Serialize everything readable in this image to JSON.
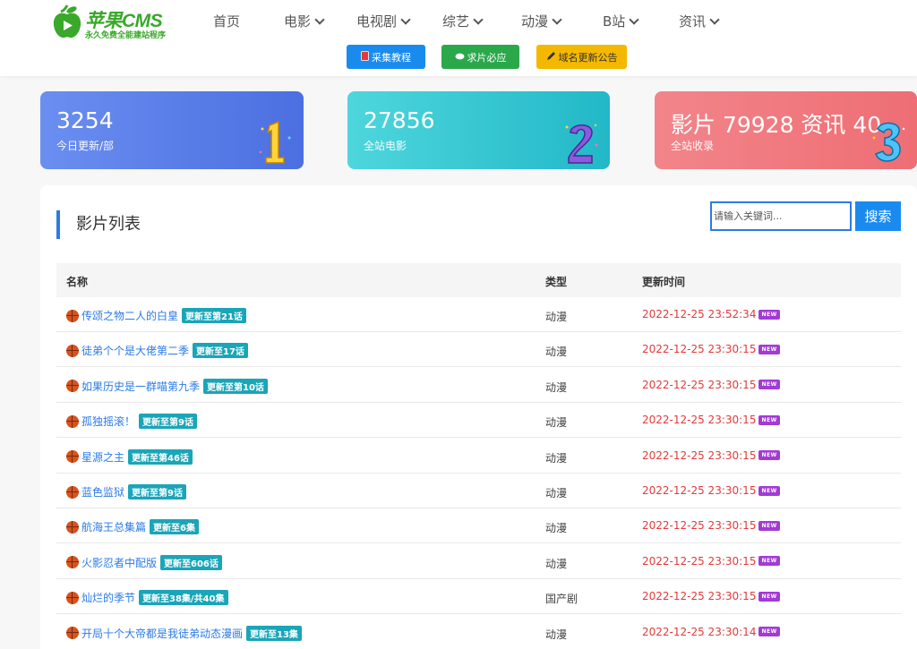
{
  "brand": {
    "title": "苹果CMS",
    "subtitle": "永久免费全能建站程序"
  },
  "nav": [
    {
      "label": "首页",
      "has_menu": false
    },
    {
      "label": "电影",
      "has_menu": true
    },
    {
      "label": "电视剧",
      "has_menu": true
    },
    {
      "label": "综艺",
      "has_menu": true
    },
    {
      "label": "动漫",
      "has_menu": true
    },
    {
      "label": "B站",
      "has_menu": true
    },
    {
      "label": "资讯",
      "has_menu": true
    }
  ],
  "quick_buttons": [
    {
      "label": "采集教程",
      "icon": "book-icon",
      "color": "#1a8bee"
    },
    {
      "label": "求片必应",
      "icon": "chat-icon",
      "color": "#2aa84a"
    },
    {
      "label": "域名更新公告",
      "icon": "pen-icon",
      "color": "#f5b800"
    }
  ],
  "stats": [
    {
      "value": "3254",
      "label": "今日更新/部",
      "badge": "1",
      "colors": [
        "#6a8ef0",
        "#4b6fe0"
      ]
    },
    {
      "value": "27856",
      "label": "全站电影",
      "badge": "2",
      "colors": [
        "#4ed6dc",
        "#22b8c8"
      ]
    },
    {
      "value": "影片 79928 资讯 40",
      "label": "全站收录",
      "badge": "3",
      "colors": [
        "#f2858a",
        "#ee6e74"
      ]
    }
  ],
  "list": {
    "title": "影片列表",
    "search_placeholder": "请输入关键词...",
    "search_button": "搜索",
    "columns": {
      "name": "名称",
      "type": "类型",
      "time": "更新时间"
    },
    "new_badge": "NEW",
    "rows": [
      {
        "title": "传颂之物二人的白皇",
        "tag": "更新至第21话",
        "type": "动漫",
        "time": "2022-12-25 23:52:34"
      },
      {
        "title": "徒弟个个是大佬第二季",
        "tag": "更新至17话",
        "type": "动漫",
        "time": "2022-12-25 23:30:15"
      },
      {
        "title": "如果历史是一群喵第九季",
        "tag": "更新至第10话",
        "type": "动漫",
        "time": "2022-12-25 23:30:15"
      },
      {
        "title": "孤独摇滚！",
        "tag": "更新至第9话",
        "type": "动漫",
        "time": "2022-12-25 23:30:15"
      },
      {
        "title": "星源之主",
        "tag": "更新至第46话",
        "type": "动漫",
        "time": "2022-12-25 23:30:15"
      },
      {
        "title": "蓝色监狱",
        "tag": "更新至第9话",
        "type": "动漫",
        "time": "2022-12-25 23:30:15"
      },
      {
        "title": "航海王总集篇",
        "tag": "更新至6集",
        "type": "动漫",
        "time": "2022-12-25 23:30:15"
      },
      {
        "title": "火影忍者中配版",
        "tag": "更新至606话",
        "type": "动漫",
        "time": "2022-12-25 23:30:15"
      },
      {
        "title": "灿烂的季节",
        "tag": "更新至38集/共40集",
        "type": "国产剧",
        "time": "2022-12-25 23:30:15"
      },
      {
        "title": "开局十个大帝都是我徒弟动态漫画",
        "tag": "更新至13集",
        "type": "动漫",
        "time": "2022-12-25 23:30:14"
      }
    ]
  }
}
